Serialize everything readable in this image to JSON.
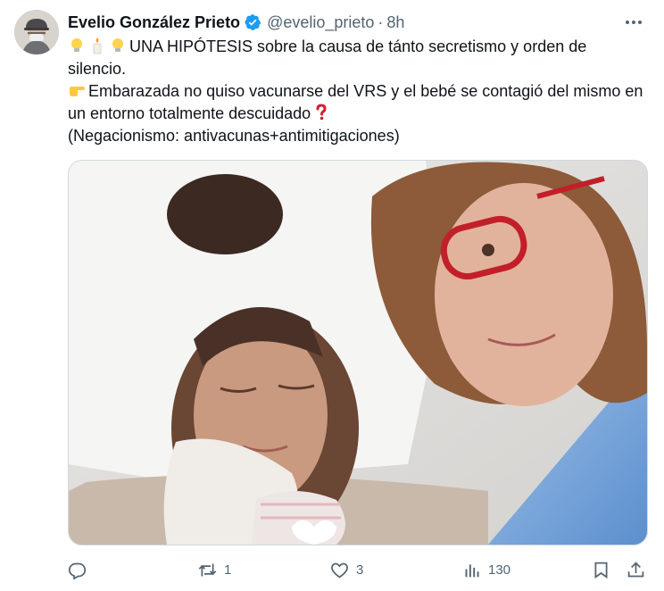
{
  "author": {
    "name": "Evelio González Prieto",
    "handle": "@evelio_prieto",
    "separator": "·",
    "time": "8h",
    "verified": true
  },
  "tweet": {
    "lines": [
      "UNA HIPÓTESIS sobre la causa de tánto secretismo y orden de silencio.",
      "Embarazada no quiso vacunarse del VRS y el bebé se contagió del mismo en un entorno totalmente descuidado",
      "(Negacionismo: antivacunas+antimitigaciones)"
    ],
    "emoji": [
      "lightbulb",
      "candle",
      "lightbulb",
      "backhand-index-pointing-right",
      "red-question-mark"
    ]
  },
  "media": {
    "kind": "photo",
    "content": "hospital bedside photo: woman with newborn on pillow, older woman with red glasses"
  },
  "actions": {
    "reply_count": "",
    "retweet_count": "1",
    "like_count": "3",
    "views_count": "130"
  },
  "icons": [
    "verified-badge-icon",
    "more-icon",
    "reply-icon",
    "retweet-icon",
    "like-icon",
    "views-icon",
    "bookmark-icon",
    "share-icon"
  ],
  "colors": {
    "accent": "#1d9bf0",
    "muted": "#536471",
    "text": "#0f1419"
  }
}
